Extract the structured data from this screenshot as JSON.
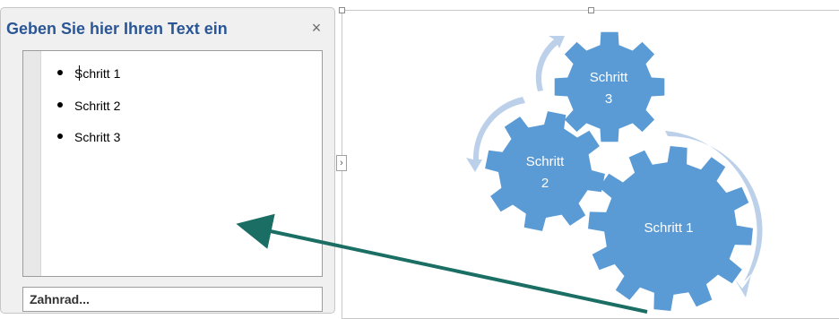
{
  "text_pane": {
    "title": "Geben Sie hier Ihren Text ein",
    "close_glyph": "×",
    "items": [
      {
        "label": "Schritt 1"
      },
      {
        "label": "Schritt 2"
      },
      {
        "label": "Schritt 3"
      }
    ],
    "footer_label": "Zahnrad..."
  },
  "diagram": {
    "expand_glyph": "›",
    "gears": [
      {
        "line1": "Schritt 1",
        "line2": ""
      },
      {
        "line1": "Schritt",
        "line2": "2"
      },
      {
        "line1": "Schritt",
        "line2": "3"
      }
    ],
    "colors": {
      "gear_fill": "#5b9bd5",
      "arrow_fill": "#bcd0ea",
      "pointer_arrow": "#1a6e64"
    }
  }
}
